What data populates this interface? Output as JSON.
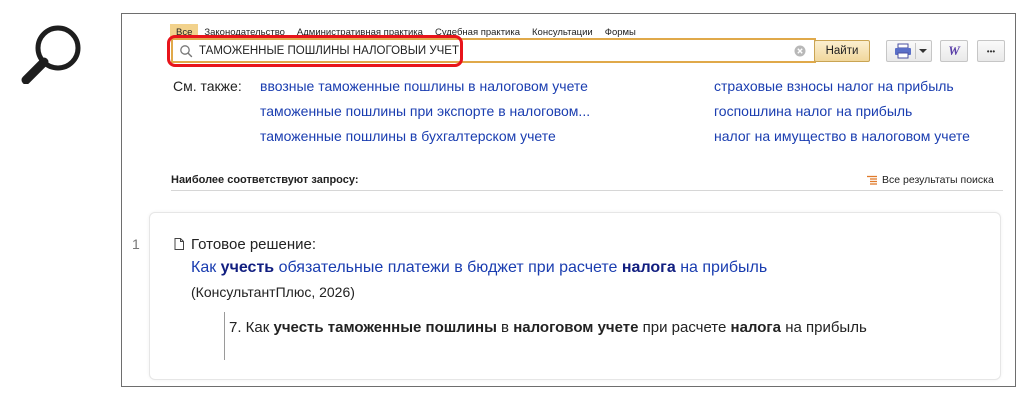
{
  "tabs": [
    {
      "label": "Все",
      "active": true
    },
    {
      "label": "Законодательство",
      "active": false
    },
    {
      "label": "Административная практика",
      "active": false
    },
    {
      "label": "Судебная практика",
      "active": false
    },
    {
      "label": "Консультации",
      "active": false
    },
    {
      "label": "Формы",
      "active": false
    }
  ],
  "search": {
    "value": "ТАМОЖЕННЫЕ ПОШЛИНЫ НАЛОГОВЫЙ УЧЕТ",
    "button_label": "Найти"
  },
  "toolbar": {
    "word_label": "W",
    "more_label": "•••"
  },
  "see_also": {
    "label": "См. также:",
    "links": [
      "ввозные таможенные пошлины в налоговом учете",
      "таможенные пошлины при экспорте в налоговом...",
      "таможенные пошлины в бухгалтерском учете",
      "страховые взносы налог на прибыль",
      "госпошлина налог на прибыль",
      "налог на имущество в налоговом учете"
    ]
  },
  "results_header": {
    "title": "Наиболее соответствуют запросу:",
    "all_results_label": "Все результаты поиска"
  },
  "result": {
    "number": "1",
    "type": "Готовое решение:",
    "title_parts": [
      "Как ",
      "учесть",
      " обязательные платежи в бюджет при расчете ",
      "налога",
      " на прибыль"
    ],
    "source": "(КонсультантПлюс, 2026)",
    "snippet_parts": [
      "7. Как ",
      "учесть таможенные пошлины",
      " в ",
      "налоговом учете",
      " при расчете ",
      "налога",
      " на прибыль"
    ]
  },
  "colors": {
    "accent": "#f2d28c",
    "link": "#1a3db0",
    "highlight": "#e8141b"
  }
}
